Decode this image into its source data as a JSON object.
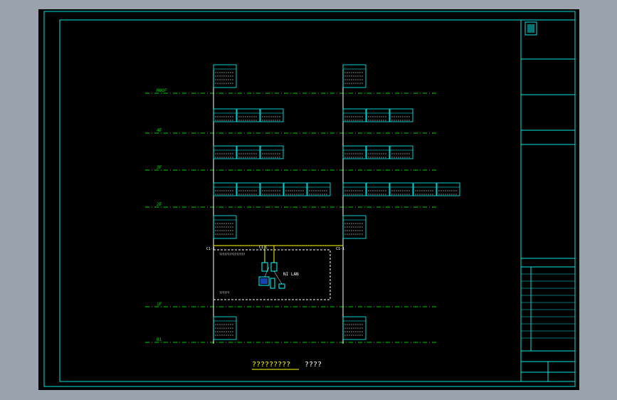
{
  "floors": [
    {
      "label": "ROOF"
    },
    {
      "label": "4F"
    },
    {
      "label": "3F"
    },
    {
      "label": "2F"
    },
    {
      "label": "1F"
    },
    {
      "label": "B1"
    }
  ],
  "lan_label": "NI LAN",
  "legend": {
    "title": "?????????",
    "subtitle": "????"
  },
  "colors": {
    "wire": "#ffffff",
    "frame": "#00e5e5",
    "level_line": "#00d000",
    "yellow": "#ffff00",
    "cyan": "#00ffff"
  }
}
